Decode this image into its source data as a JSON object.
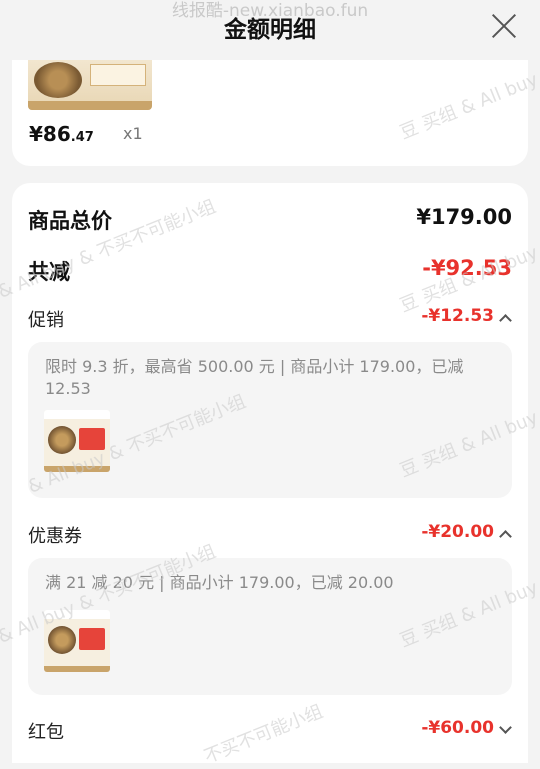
{
  "header": {
    "watermark": "线报酷-new.xianbao.fun",
    "title": "金额明细"
  },
  "product": {
    "price_main": "¥86",
    "price_decimal": ".47",
    "qty": "x1"
  },
  "summary": {
    "total_label": "商品总价",
    "total_value": "¥179.00",
    "discount_label": "共减",
    "discount_value": "-¥92.53"
  },
  "promotion": {
    "label": "促销",
    "value": "-¥12.53",
    "desc": "限时 9.3 折，最高省 500.00 元 | 商品小计 179.00，已减 12.53"
  },
  "coupon": {
    "label": "优惠券",
    "value": "-¥20.00",
    "desc": "满 21 减 20 元 | 商品小计 179.00，已减 20.00"
  },
  "redpacket": {
    "label": "红包",
    "value": "-¥60.00"
  },
  "watermarks": {
    "a": "豆 买组 & All buy",
    "b": "& All buy & 不买不可能小组",
    "c": "不买不可能小组"
  }
}
